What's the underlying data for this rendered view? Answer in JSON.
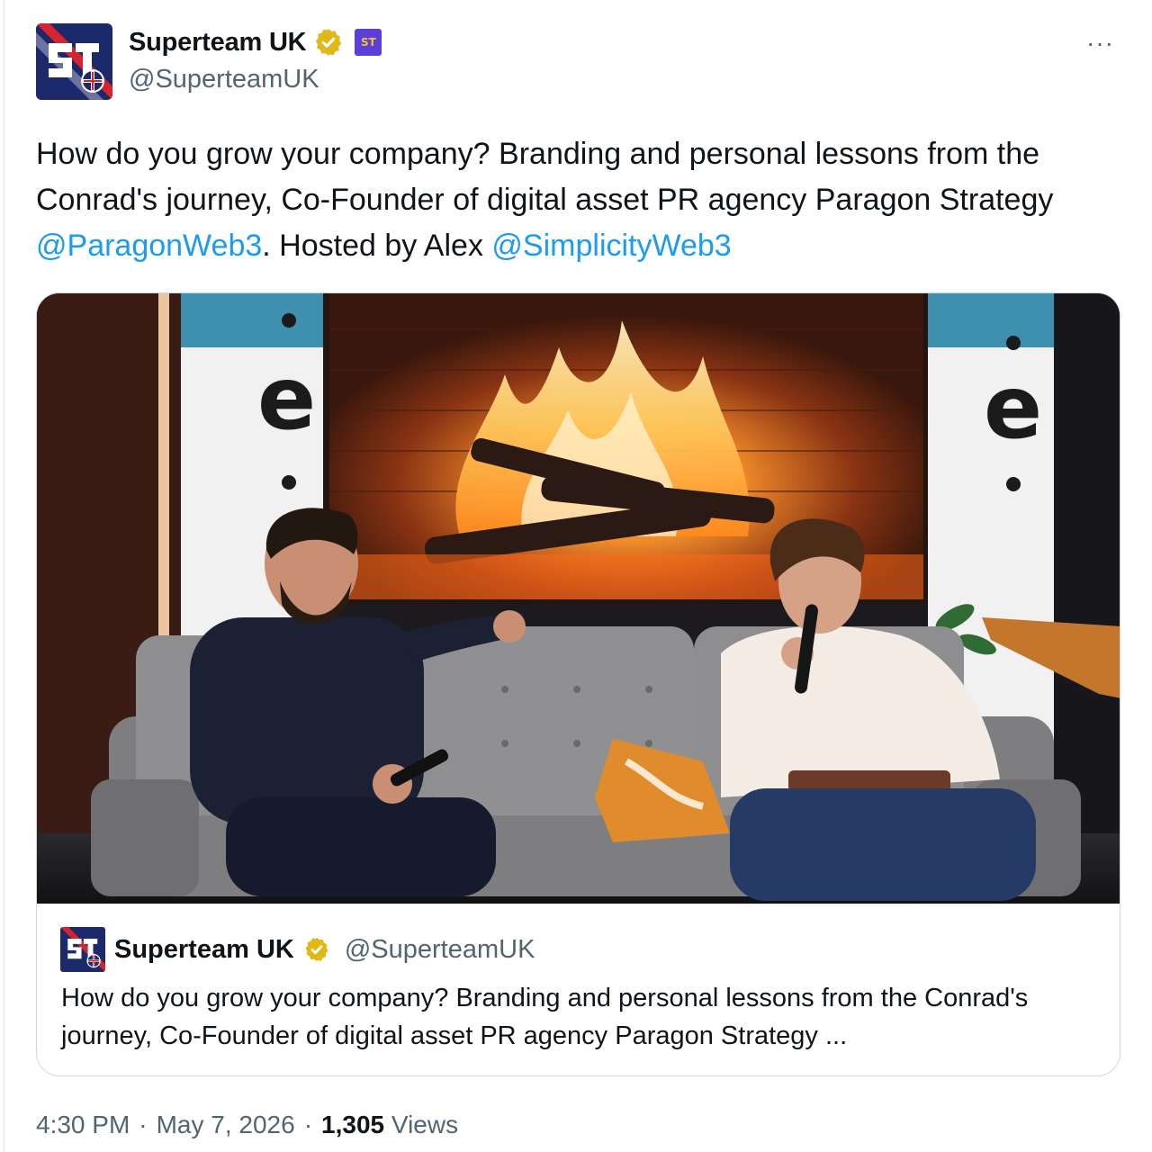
{
  "author": {
    "display_name": "Superteam UK",
    "handle": "@SuperteamUK",
    "verified_icon": "gold-verified-badge-icon",
    "affiliate_badge_icon": "superteam-affiliate-badge-icon",
    "badge_letters": "ST"
  },
  "menu": {
    "more_label": "···"
  },
  "tweet": {
    "segments": [
      {
        "type": "text",
        "value": "How do you grow your company? Branding and personal lessons from the Conrad's journey, Co-Founder of digital asset PR agency Paragon Strategy "
      },
      {
        "type": "mention",
        "value": "@ParagonWeb3"
      },
      {
        "type": "text",
        "value": ". Hosted by Alex "
      },
      {
        "type": "mention",
        "value": "@SimplicityWeb3"
      }
    ]
  },
  "quote": {
    "display_name": "Superteam UK",
    "handle": "@SuperteamUK",
    "text": "How do you grow your company? Branding and personal lessons from the Conrad's journey, Co-Founder of digital asset PR agency Paragon Strategy ...",
    "media_description": "Two men seated on a grey sofa holding microphones in front of a large screen showing a fireplace",
    "screen_logo_letter": "e"
  },
  "footer": {
    "time": "4:30 PM",
    "separator": "·",
    "date": "May 7, 2026",
    "views_count": "1,305",
    "views_label": "Views"
  },
  "colors": {
    "link": "#1d9bf0",
    "secondary_text": "#536471",
    "border": "#cfd9de",
    "verified_gold": "#e2b719",
    "affiliate_purple": "#5b3fd6",
    "brand_navy": "#1c2a6b",
    "brand_red": "#d6232e"
  }
}
